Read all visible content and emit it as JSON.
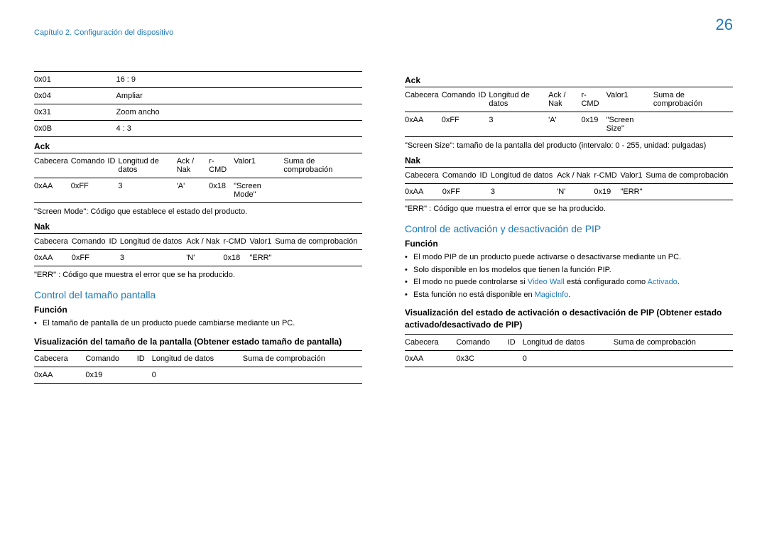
{
  "page_number": "26",
  "chapter": "Capítulo 2. Configuración del dispositivo",
  "left": {
    "table1": {
      "r1": {
        "c1": "0x01",
        "c2": "16 : 9"
      },
      "r2": {
        "c1": "0x04",
        "c2": "Ampliar"
      },
      "r3": {
        "c1": "0x31",
        "c2": "Zoom ancho"
      },
      "r4": {
        "c1": "0x0B",
        "c2": "4 : 3"
      }
    },
    "ack_label": "Ack",
    "ack_table": {
      "h1": "Cabecera",
      "h2": "Comando",
      "h3": "ID",
      "h4": "Longitud de datos",
      "h5": "Ack / Nak",
      "h6": "r-CMD",
      "h7": "Valor1",
      "h8": "Suma de comprobación",
      "r1": {
        "c1": "0xAA",
        "c2": "0xFF",
        "c3": "",
        "c4": "3",
        "c5": "'A'",
        "c6": "0x18",
        "c7": "\"Screen Mode\"",
        "c8": ""
      }
    },
    "ack_note": "\"Screen Mode\": Código que establece el estado del producto.",
    "nak_label": "Nak",
    "nak_table": {
      "h1": "Cabecera",
      "h2": "Comando",
      "h3": "ID",
      "h4": "Longitud de datos",
      "h5": "Ack / Nak",
      "h6": "r-CMD",
      "h7": "Valor1",
      "h8": "Suma de comprobación",
      "r1": {
        "c1": "0xAA",
        "c2": "0xFF",
        "c3": "",
        "c4": "3",
        "c5": "'N'",
        "c6": "0x18",
        "c7": "\"ERR\"",
        "c8": ""
      }
    },
    "nak_note": "\"ERR\" : Código que muestra el error que se ha producido.",
    "section_title": "Control del tamaño pantalla",
    "funcion_label": "Función",
    "funcion_bullet": "El tamaño de pantalla de un producto puede cambiarse mediante un PC.",
    "viz_label": "Visualización del tamaño de la pantalla (Obtener estado tamaño de pantalla)",
    "viz_table": {
      "h1": "Cabecera",
      "h2": "Comando",
      "h3": "ID",
      "h4": "Longitud de datos",
      "h5": "Suma de comprobación",
      "r1": {
        "c1": "0xAA",
        "c2": "0x19",
        "c3": "",
        "c4": "0",
        "c5": ""
      }
    }
  },
  "right": {
    "ack_label": "Ack",
    "ack_table": {
      "h1": "Cabecera",
      "h2": "Comando",
      "h3": "ID",
      "h4": "Longitud de datos",
      "h5": "Ack / Nak",
      "h6": "r-CMD",
      "h7": "Valor1",
      "h8": "Suma de comprobación",
      "r1": {
        "c1": "0xAA",
        "c2": "0xFF",
        "c3": "",
        "c4": "3",
        "c5": "'A'",
        "c6": "0x19",
        "c7": "\"Screen Size\"",
        "c8": ""
      }
    },
    "ack_note": "\"Screen Size\": tamaño de la pantalla del producto (intervalo: 0 - 255, unidad: pulgadas)",
    "nak_label": "Nak",
    "nak_table": {
      "h1": "Cabecera",
      "h2": "Comando",
      "h3": "ID",
      "h4": "Longitud de datos",
      "h5": "Ack / Nak",
      "h6": "r-CMD",
      "h7": "Valor1",
      "h8": "Suma de comprobación",
      "r1": {
        "c1": "0xAA",
        "c2": "0xFF",
        "c3": "",
        "c4": "3",
        "c5": "'N'",
        "c6": "0x19",
        "c7": "\"ERR\"",
        "c8": ""
      }
    },
    "nak_note": "\"ERR\" : Código que muestra el error que se ha producido.",
    "section_title": "Control de activación y desactivación de PIP",
    "funcion_label": "Función",
    "bullet1": "El modo PIP de un producto puede activarse o desactivarse mediante un PC.",
    "bullet2": "Solo disponible en los modelos que tienen la función PIP.",
    "bullet3a": "El modo no puede controlarse si ",
    "bullet3_term1": "Video Wall",
    "bullet3b": " está configurado como ",
    "bullet3_term2": "Activado",
    "bullet3c": ".",
    "bullet4a": "Esta función no está disponible en ",
    "bullet4_term": "MagicInfo",
    "bullet4b": ".",
    "viz_label": "Visualización del estado de activación o desactivación de PIP (Obtener estado activado/desactivado de PIP)",
    "viz_table": {
      "h1": "Cabecera",
      "h2": "Comando",
      "h3": "ID",
      "h4": "Longitud de datos",
      "h5": "Suma de comprobación",
      "r1": {
        "c1": "0xAA",
        "c2": "0x3C",
        "c3": "",
        "c4": "0",
        "c5": ""
      }
    }
  }
}
